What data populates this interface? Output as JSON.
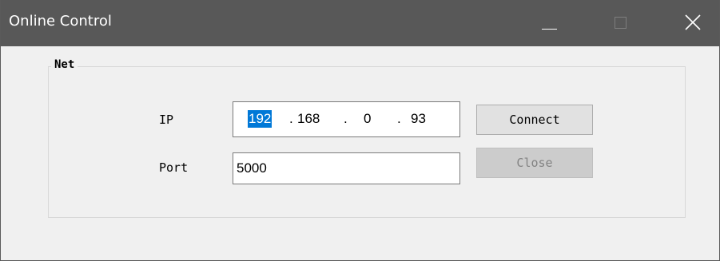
{
  "window": {
    "title": "Online Control",
    "controls": {
      "minimize_icon": "minimize-icon",
      "maximize_icon": "maximize-icon",
      "close_icon": "close-icon"
    }
  },
  "net_group": {
    "legend": "Net",
    "ip": {
      "label": "IP",
      "octets": [
        "192",
        "168",
        "0",
        "93"
      ],
      "separator": ".",
      "selected_octet": 0
    },
    "port": {
      "label": "Port",
      "value": "5000"
    },
    "connect_button": {
      "label": "Connect",
      "enabled": true
    },
    "close_button": {
      "label": "Close",
      "enabled": false
    }
  },
  "colors": {
    "titlebar": "#585858",
    "dialog_bg": "#f0f0f0",
    "selection": "#0078d7",
    "disabled_text": "#838383"
  }
}
